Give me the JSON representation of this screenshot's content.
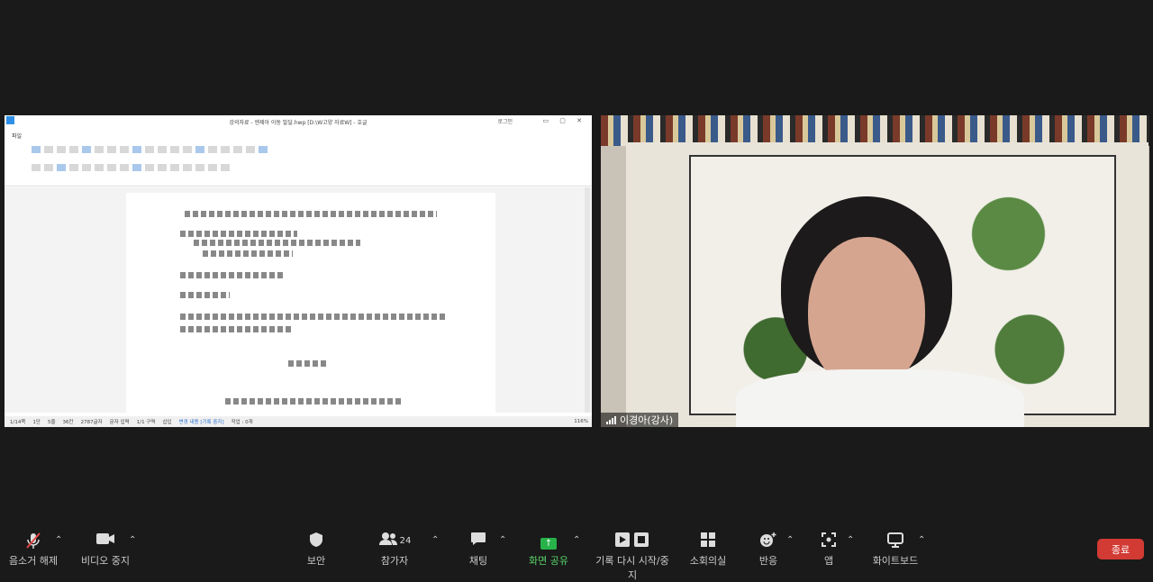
{
  "shared_window": {
    "title": "강의자료 - 엔제아 아동 발달.hwp [D:\\W고양 자료W] - 호글",
    "login": "로그인",
    "menu_tab": "파일",
    "status": {
      "page": "1/14쪽",
      "section": "1단",
      "line": "5줄",
      "col": "36칸",
      "chars": "2787글자",
      "input": "문자 입력",
      "division": "1/1 구역",
      "insert": "삽입",
      "track": "변경 내용 [기록 중지]",
      "jobs": "작업 : 0개",
      "zoom": "116%"
    }
  },
  "video": {
    "speaker_name": "이경아(강사)"
  },
  "toolbar": {
    "unmute": "음소거 해제",
    "stop_video": "비디오 중지",
    "security": "보안",
    "participants": "참가자",
    "participant_count": "24",
    "chat": "채팅",
    "share": "화면 공유",
    "record": "기록 다시 시작/중지",
    "breakout": "소회의실",
    "reactions": "반응",
    "apps": "앱",
    "whiteboard": "화이트보드",
    "end": "종료"
  },
  "colors": {
    "background": "#1a1a1a",
    "share_green": "#27b24a",
    "end_red": "#d23a34"
  }
}
